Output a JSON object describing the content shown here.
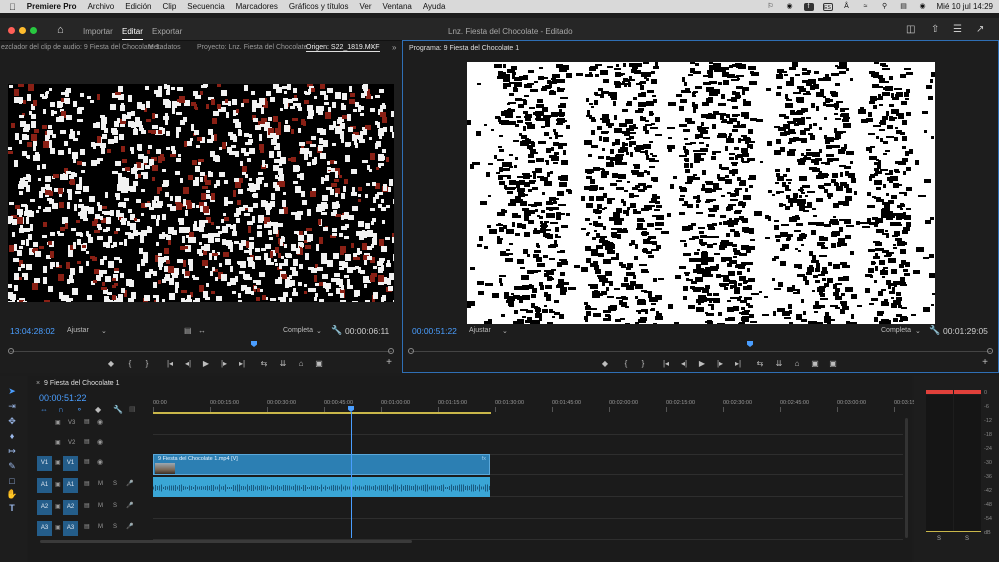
{
  "menubar": {
    "apple": "",
    "app": "Premiere Pro",
    "items": [
      "Archivo",
      "Edición",
      "Clip",
      "Secuencia",
      "Marcadores",
      "Gráficos y títulos",
      "Ver",
      "Ventana",
      "Ayuda"
    ],
    "clock": "Mié 10 jul 14:29"
  },
  "titlebar": {
    "tabs": [
      "Importar",
      "Editar",
      "Exportar"
    ],
    "active_tab": "Editar",
    "title": "Lnz. Fiesta del Chocolate - Editado"
  },
  "source": {
    "tabs": [
      "ezclador del clip de audio: 9 Fiesta del Chocolate 1",
      "Metadatos",
      "Proyecto: Lnz. Fiesta del Chocolate",
      "Origen: S22_1819.MXF"
    ],
    "timecode": "13:04:28:02",
    "fit": "Ajustar",
    "quality": "Completa",
    "duration": "00:00:06:11",
    "playhead_fraction": 0.64
  },
  "program": {
    "tab": "Programa: 9 Fiesta del Chocolate 1",
    "timecode": "00:00:51:22",
    "fit": "Ajustar",
    "quality": "Completa",
    "duration": "00:01:29:05",
    "playhead_fraction": 0.585
  },
  "transport": {
    "marker": "◆",
    "in": "{",
    "out": "}",
    "go_in": "|◂",
    "step_back": "◂|",
    "play": "▶",
    "step_fwd": "|▸",
    "go_out": "▸|",
    "insert": "⇆",
    "overwrite": "⇊",
    "camera": "⌂",
    "compare": "▣",
    "add": "+"
  },
  "timeline": {
    "tab": "9 Fiesta del Chocolate 1",
    "timecode": "00:00:51:22",
    "ruler": [
      "00:00",
      "00:00:15:00",
      "00:00:30:00",
      "00:00:45:00",
      "00:01:00:00",
      "00:01:15:00",
      "00:01:30:00",
      "00:01:45:00",
      "00:02:00:00",
      "00:02:15:00",
      "00:02:30:00",
      "00:02:45:00",
      "00:03:00:00",
      "00:03:15:0"
    ],
    "tracks": [
      {
        "patch": "",
        "name": "V3",
        "m": "",
        "s": ""
      },
      {
        "patch": "",
        "name": "V2",
        "m": "",
        "s": ""
      },
      {
        "patch": "V1",
        "name": "V1",
        "m": "",
        "s": ""
      },
      {
        "patch": "A1",
        "name": "A1",
        "m": "M",
        "s": "S"
      },
      {
        "patch": "A2",
        "name": "A2",
        "m": "M",
        "s": "S"
      },
      {
        "patch": "A3",
        "name": "A3",
        "m": "M",
        "s": "S"
      }
    ],
    "video_clip": "9 Fiesta del Chocolate 1.mp4 [V]",
    "clip_fx": "fx",
    "playhead_fraction": 0.264,
    "clip_end_fraction": 0.449
  },
  "meters": {
    "scale": [
      "0",
      "-6",
      "-12",
      "-18",
      "-24",
      "-30",
      "-36",
      "-42",
      "-48",
      "-54",
      "dB"
    ],
    "solo": [
      "S",
      "S"
    ]
  },
  "colors": {
    "accent": "#4a9eff",
    "clip_video": "#2c7fb3",
    "clip_audio": "#3aa6d6",
    "patch": "#245d8a",
    "meter_peak": "#e0403a",
    "work_area": "#c9b74a"
  }
}
